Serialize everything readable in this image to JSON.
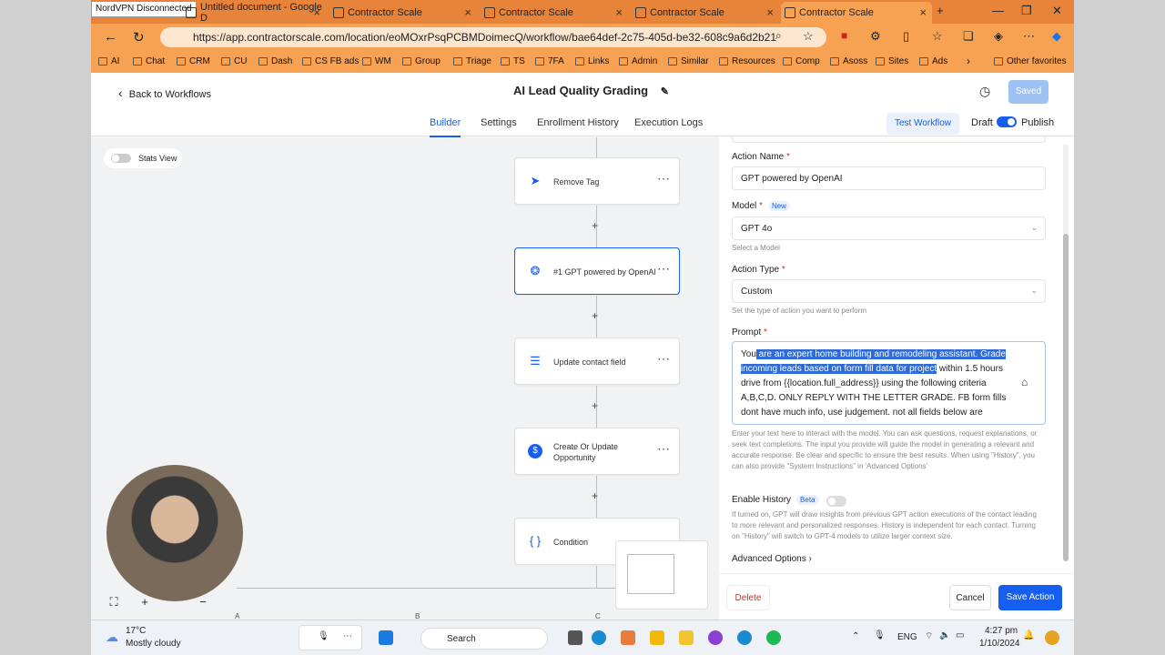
{
  "browser": {
    "vpn_status": "NordVPN Disconnected",
    "tabs": [
      {
        "label": "Untitled document - Google D"
      },
      {
        "label": "Contractor Scale"
      },
      {
        "label": "Contractor Scale"
      },
      {
        "label": "Contractor Scale"
      },
      {
        "label": "Contractor Scale"
      }
    ],
    "url": "https://app.contractorscale.com/location/eoMOxrPsqPCBMDoimecQ/workflow/bae64def-2c75-405d-be32-608c9a6d2b21",
    "bookmarks": [
      "AI",
      "Chat",
      "CRM",
      "CU",
      "Dash",
      "CS FB ads",
      "WM",
      "Group",
      "Triage",
      "TS",
      "7FA",
      "Links",
      "Admin",
      "Similar",
      "Resources",
      "Comp",
      "Asoss",
      "Sites",
      "Ads"
    ],
    "other_favorites": "Other favorites"
  },
  "header": {
    "back_label": "Back to Workflows",
    "title": "AI Lead Quality Grading",
    "saved_label": "Saved",
    "tabs": [
      "Builder",
      "Settings",
      "Enrollment History",
      "Execution Logs"
    ],
    "test_workflow": "Test Workflow",
    "draft": "Draft",
    "publish": "Publish"
  },
  "canvas": {
    "stats_view": "Stats View",
    "nodes": [
      {
        "label": "Remove Tag"
      },
      {
        "label": "#1 GPT powered by OpenAI"
      },
      {
        "label": "Update contact field"
      },
      {
        "label": "Create Or Update Opportunity"
      },
      {
        "label": "Condition"
      }
    ],
    "branch_labels": [
      "A",
      "B",
      "C"
    ]
  },
  "panel": {
    "action_name_label": "Action Name",
    "action_name_value": "GPT powered by OpenAI",
    "model_label": "Model",
    "model_badge": "New",
    "model_value": "GPT 4o",
    "model_hint": "Select a Model",
    "action_type_label": "Action Type",
    "action_type_value": "Custom",
    "action_type_hint": "Set the type of action you want to perform",
    "prompt_label": "Prompt",
    "prompt_part1": "You",
    "prompt_selected": " are an expert home building and remodeling assistant. Grade incoming leads based on form fill data for project",
    "prompt_rest": " within 1.5 hours drive from {{location.full_address}} using the following criteria A,B,C,D. ONLY REPLY WITH THE LETTER GRADE. FB form fills dont have much info, use judgement. not all fields below are",
    "prompt_hint": "Enter your text here to interact with the model. You can ask questions, request explanations, or seek text completions. The input you provide will guide the model in generating a relevant and accurate response. Be clear and specific to ensure the best results. When using \"History\", you can also provide \"System Instructions\" in 'Advanced Options'",
    "history_label": "Enable History",
    "history_badge": "Beta",
    "history_hint": "If turned on, GPT will draw insights from previous GPT action executions of the contact leading to more relevant and personalized responses. History is independent for each contact. Turning on \"History\" will switch to GPT-4 models to utilize larger context size.",
    "advanced": "Advanced Options",
    "delete": "Delete",
    "cancel": "Cancel",
    "save": "Save Action"
  },
  "taskbar": {
    "weather_temp": "17°C",
    "weather_desc": "Mostly cloudy",
    "search": "Search",
    "lang": "ENG",
    "time": "4:27 pm",
    "date": "1/10/2024"
  }
}
